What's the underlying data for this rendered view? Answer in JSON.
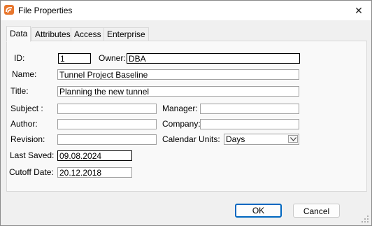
{
  "window": {
    "title": "File Properties"
  },
  "tabs": [
    {
      "label": "Data"
    },
    {
      "label": "Attributes"
    },
    {
      "label": "Access"
    },
    {
      "label": "Enterprise Fields"
    }
  ],
  "form": {
    "id_label": "ID:",
    "id_value": "1",
    "owner_label": "Owner:",
    "owner_value": "DBA",
    "name_label": "Name:",
    "name_value": "Tunnel Project Baseline",
    "title_label": "Title:",
    "title_value": "Planning the new tunnel",
    "subject_label": "Subject :",
    "subject_value": "",
    "manager_label": "Manager:",
    "manager_value": "",
    "author_label": "Author:",
    "author_value": "",
    "company_label": "Company:",
    "company_value": "",
    "revision_label": "Revision:",
    "revision_value": "",
    "calendar_units_label": "Calendar Units:",
    "calendar_units_value": "Days",
    "last_saved_label": "Last Saved:",
    "last_saved_value": "09.08.2024",
    "cutoff_date_label": "Cutoff Date:",
    "cutoff_date_value": "20.12.2018"
  },
  "buttons": {
    "ok": "OK",
    "cancel": "Cancel"
  },
  "icons": {
    "app": "app-icon",
    "close": "close-icon",
    "dropdown": "chevron-down-icon",
    "grip": "resize-grip-icon"
  },
  "colors": {
    "accent": "#0067c0",
    "app_icon": "#e8772e"
  }
}
